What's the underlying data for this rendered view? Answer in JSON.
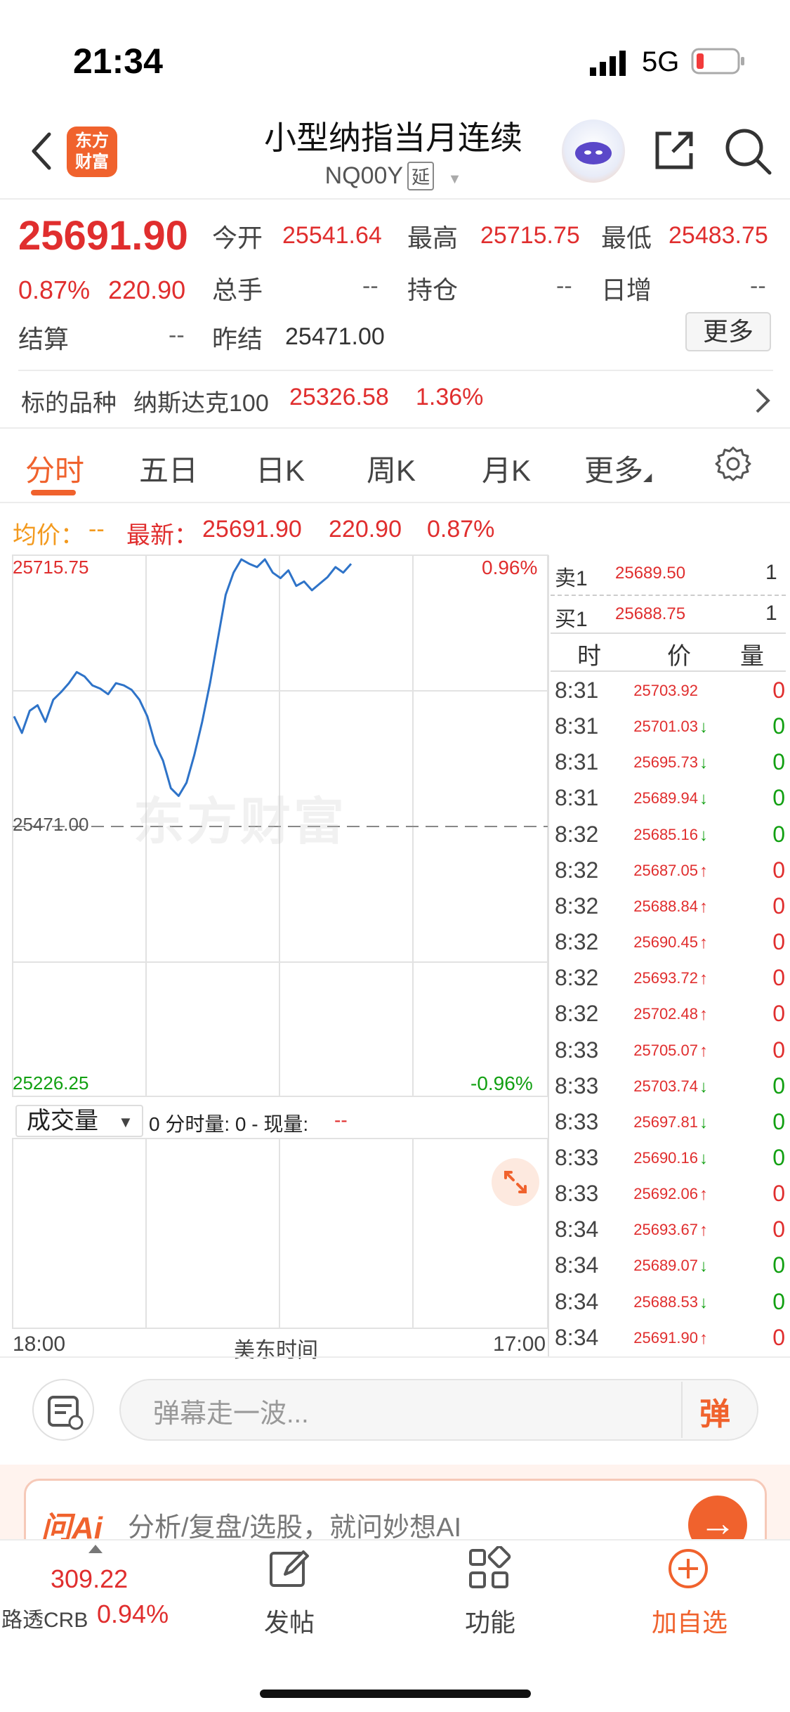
{
  "status_bar": {
    "time": "21:34",
    "network": "5G"
  },
  "header": {
    "logo_line1": "东方",
    "logo_line2": "财富",
    "title": "小型纳指当月连续",
    "code": "NQ00Y",
    "delay_tag": "延"
  },
  "quote": {
    "last": "25691.90",
    "change_pct": "0.87%",
    "change": "220.90",
    "open_label": "今开",
    "open": "25541.64",
    "high_label": "最高",
    "high": "25715.75",
    "low_label": "最低",
    "low": "25483.75",
    "volume_label": "总手",
    "volume": "--",
    "oi_label": "持仓",
    "oi": "--",
    "daily_inc_label": "日增",
    "daily_inc": "--",
    "settle_label": "结算",
    "settle": "--",
    "prev_settle_label": "昨结",
    "prev_settle": "25471.00",
    "more_button": "更多"
  },
  "underlying": {
    "label": "标的品种",
    "name": "纳斯达克100",
    "price": "25326.58",
    "pct": "1.36%"
  },
  "tabs": [
    "分时",
    "五日",
    "日K",
    "周K",
    "月K",
    "更多"
  ],
  "info_line": {
    "avg_label": "均价：",
    "avg_value": "--",
    "latest_label": "最新：",
    "latest_value": "25691.90",
    "latest_change": "220.90",
    "latest_pct": "0.87%"
  },
  "chart_data": {
    "type": "line",
    "title": "",
    "xlabel": "美东时间",
    "x_start": "18:00",
    "x_end": "17:00",
    "y_max": "25715.75",
    "y_ref": "25471.00",
    "y_min": "25226.25",
    "pct_max": "0.96%",
    "pct_min": "-0.96%",
    "ylim": [
      25226.25,
      25715.75
    ],
    "reference_line": 25471.0,
    "grid": true,
    "watermark": "东方财富",
    "series": [
      {
        "values": [
          25570,
          25555,
          25575,
          25580,
          25565,
          25585,
          25592,
          25600,
          25610,
          25606,
          25598,
          25595,
          25590,
          25600,
          25598,
          25594,
          25585,
          25570,
          25545,
          25530,
          25505,
          25498,
          25510,
          25535,
          25565,
          25600,
          25640,
          25680,
          25700,
          25712,
          25708,
          25705,
          25712,
          25700,
          25695,
          25702,
          25688,
          25692,
          25684,
          25690,
          25696,
          25705,
          25700,
          25708
        ]
      }
    ]
  },
  "volume_panel": {
    "selector": "成交量",
    "info": "0 分时量: 0 - 现量:",
    "now": "--"
  },
  "order_book": {
    "ask_label": "卖1",
    "ask_price": "25689.50",
    "ask_qty": "1",
    "bid_label": "买1",
    "bid_price": "25688.75",
    "bid_qty": "1"
  },
  "ticks": {
    "headers": [
      "时",
      "价",
      "量"
    ],
    "rows": [
      {
        "time": "8:31",
        "price": "25703.92",
        "dir": "",
        "vol": "0",
        "color": "#e02e2e"
      },
      {
        "time": "8:31",
        "price": "25701.03",
        "dir": "↓",
        "vol": "0",
        "color": "#12a012"
      },
      {
        "time": "8:31",
        "price": "25695.73",
        "dir": "↓",
        "vol": "0",
        "color": "#12a012"
      },
      {
        "time": "8:31",
        "price": "25689.94",
        "dir": "↓",
        "vol": "0",
        "color": "#12a012"
      },
      {
        "time": "8:32",
        "price": "25685.16",
        "dir": "↓",
        "vol": "0",
        "color": "#12a012"
      },
      {
        "time": "8:32",
        "price": "25687.05",
        "dir": "↑",
        "vol": "0",
        "color": "#e02e2e"
      },
      {
        "time": "8:32",
        "price": "25688.84",
        "dir": "↑",
        "vol": "0",
        "color": "#e02e2e"
      },
      {
        "time": "8:32",
        "price": "25690.45",
        "dir": "↑",
        "vol": "0",
        "color": "#e02e2e"
      },
      {
        "time": "8:32",
        "price": "25693.72",
        "dir": "↑",
        "vol": "0",
        "color": "#e02e2e"
      },
      {
        "time": "8:32",
        "price": "25702.48",
        "dir": "↑",
        "vol": "0",
        "color": "#e02e2e"
      },
      {
        "time": "8:33",
        "price": "25705.07",
        "dir": "↑",
        "vol": "0",
        "color": "#e02e2e"
      },
      {
        "time": "8:33",
        "price": "25703.74",
        "dir": "↓",
        "vol": "0",
        "color": "#12a012"
      },
      {
        "time": "8:33",
        "price": "25697.81",
        "dir": "↓",
        "vol": "0",
        "color": "#12a012"
      },
      {
        "time": "8:33",
        "price": "25690.16",
        "dir": "↓",
        "vol": "0",
        "color": "#12a012"
      },
      {
        "time": "8:33",
        "price": "25692.06",
        "dir": "↑",
        "vol": "0",
        "color": "#e02e2e"
      },
      {
        "time": "8:34",
        "price": "25693.67",
        "dir": "↑",
        "vol": "0",
        "color": "#e02e2e"
      },
      {
        "time": "8:34",
        "price": "25689.07",
        "dir": "↓",
        "vol": "0",
        "color": "#12a012"
      },
      {
        "time": "8:34",
        "price": "25688.53",
        "dir": "↓",
        "vol": "0",
        "color": "#12a012"
      },
      {
        "time": "8:34",
        "price": "25691.90",
        "dir": "↑",
        "vol": "0",
        "color": "#e02e2e"
      }
    ]
  },
  "danmu": {
    "placeholder": "弹幕走一波...",
    "send": "弹"
  },
  "ai_banner": {
    "logo": "问Ai",
    "text": "分析/复盘/选股，就问妙想AI",
    "go_icon": "→"
  },
  "bottom_nav": {
    "crb_value": "309.22",
    "crb_name": "路透CRB",
    "crb_pct": "0.94%",
    "post": "发帖",
    "function": "功能",
    "add_watch": "加自选"
  },
  "colors": {
    "up": "#e02e2e",
    "down": "#12a012",
    "accent": "#f0622d",
    "line": "#2e73c8"
  }
}
